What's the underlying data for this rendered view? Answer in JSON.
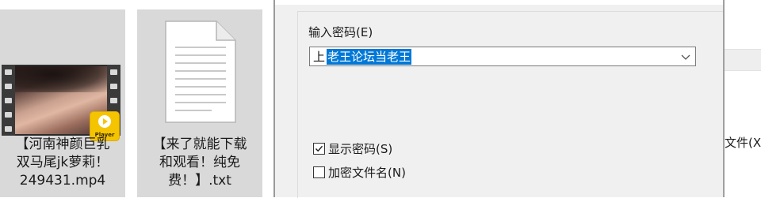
{
  "explorer": {
    "files": [
      {
        "type": "video",
        "icon": "video-thumbnail-icon",
        "badge_text": "Player",
        "name_lines": [
          "【河南神颜巨乳",
          "双马尾jk萝莉！",
          "249431.mp4"
        ]
      },
      {
        "type": "text",
        "icon": "text-document-icon",
        "name_lines": [
          "【来了就能下载",
          "和观看！纯免",
          "费！】.txt"
        ]
      }
    ]
  },
  "dialog": {
    "password_label": "输入密码(E)",
    "password_value_first": "上",
    "password_value_selected": "老王论坛当老王",
    "show_password_label": "显示密码(S)",
    "show_password_checked": true,
    "encrypt_filenames_label": "加密文件名(N)",
    "encrypt_filenames_checked": false
  },
  "right_panel": {
    "partial_text": "文件(X"
  },
  "colors": {
    "selection": "#0078d7",
    "tile_background": "#d9d9d9",
    "dialog_background": "#f0f0f0",
    "badge": "#f5c400"
  }
}
